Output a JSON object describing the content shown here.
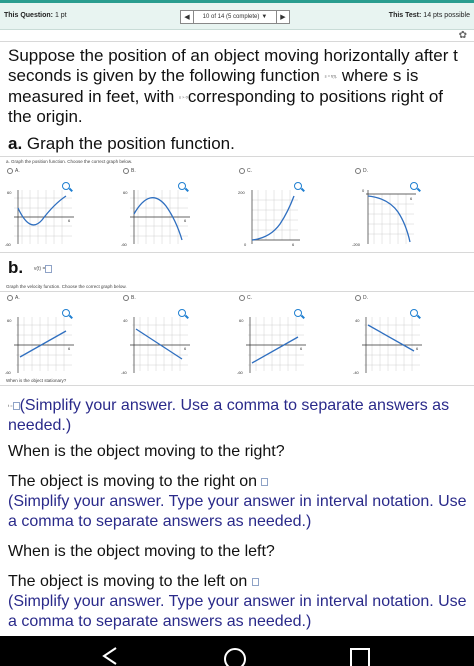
{
  "header": {
    "question_prefix": "This Question:",
    "question_points": "1 pt",
    "progress": "10 of 14 (5 complete)",
    "test_prefix": "This Test:",
    "test_points": "14 pts possible"
  },
  "question": {
    "intro": "Suppose the position of an object moving horizontally after t seconds is given by the following function",
    "inline_fn": "s = f(t),",
    "where_text": "where s is measured in feet, with",
    "inline_s0": "s > 0",
    "corresponding": "corresponding to positions right of the origin.",
    "part_a_letter": "a.",
    "part_a_text": "Graph the position function.",
    "part_a_sub": "a. Graph the position function. Choose the correct graph below.",
    "part_b_letter": "b.",
    "part_b_inline": "v(t) =",
    "part_b_sub": "Graph the velocity function. Choose the correct graph below.",
    "stationary_q": "When is the object stationary?",
    "t_prefix": "t =",
    "simplify_comma": "(Simplify your answer. Use a comma to separate answers as needed.)",
    "right_q": "When is the object moving to the right?",
    "right_answer": "The object is moving to the right on",
    "simplify_interval": "(Simplify your answer. Type your answer in interval notation. Use a comma to separate answers as needed.)",
    "left_q": "When is the object moving to the left?",
    "left_answer": "The object is moving to the left on"
  },
  "position_options": [
    {
      "label": "A.",
      "y_top": "60",
      "y_bot": "-60",
      "x_end": "6"
    },
    {
      "label": "B.",
      "y_top": "60",
      "y_bot": "-60",
      "x_end": "6"
    },
    {
      "label": "C.",
      "y_top": "200",
      "y_bot": "0",
      "x_end": "6"
    },
    {
      "label": "D.",
      "y_top": "0",
      "y_bot": "-200",
      "x_end": "6"
    }
  ],
  "velocity_options": [
    {
      "label": "A.",
      "y_top": "60",
      "y_bot": "-60",
      "x_end": "6"
    },
    {
      "label": "B.",
      "y_top": "40",
      "y_bot": "-40",
      "x_end": "6"
    },
    {
      "label": "C.",
      "y_top": "60",
      "y_bot": "-60",
      "x_end": "6"
    },
    {
      "label": "D.",
      "y_top": "40",
      "y_bot": "-40",
      "x_end": "6"
    }
  ],
  "colors": {
    "accent": "#2a9d8f",
    "curve": "#2f6fc0",
    "link_text": "#2a2a8a"
  }
}
